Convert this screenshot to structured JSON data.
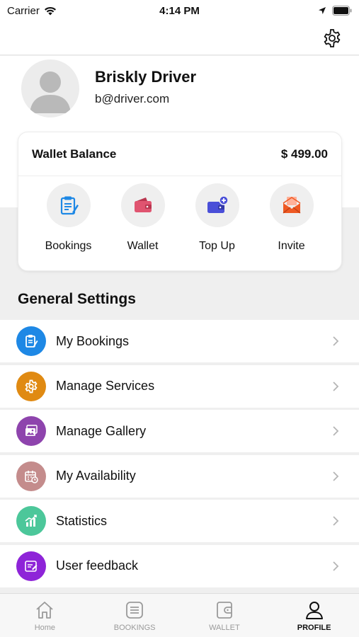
{
  "status_bar": {
    "carrier": "Carrier",
    "time": "4:14 PM"
  },
  "profile": {
    "name": "Briskly Driver",
    "email": "b@driver.com"
  },
  "wallet": {
    "label": "Wallet Balance",
    "amount": "$ 499.00",
    "actions": [
      {
        "label": "Bookings",
        "icon": "clipboard-icon",
        "color": "#1e88e5"
      },
      {
        "label": "Wallet",
        "icon": "wallet-icon",
        "color": "#e05470"
      },
      {
        "label": "Top Up",
        "icon": "top-up-icon",
        "color": "#4a4fd8"
      },
      {
        "label": "Invite",
        "icon": "envelope-icon",
        "color": "#ef5a24"
      }
    ]
  },
  "general_settings": {
    "title": "General Settings",
    "items": [
      {
        "label": "My Bookings",
        "icon": "clipboard-icon",
        "color": "#1e88e5"
      },
      {
        "label": "Manage Services",
        "icon": "gear-icon",
        "color": "#e08a12"
      },
      {
        "label": "Manage Gallery",
        "icon": "gallery-icon",
        "color": "#8e44ad"
      },
      {
        "label": "My Availability",
        "icon": "calendar-icon",
        "color": "#c48c8c"
      },
      {
        "label": "Statistics",
        "icon": "chart-icon",
        "color": "#4cc79a"
      },
      {
        "label": "User feedback",
        "icon": "feedback-icon",
        "color": "#8e24d8"
      }
    ]
  },
  "tab_bar": {
    "tabs": [
      {
        "label": "Home",
        "icon": "home-icon",
        "active": false
      },
      {
        "label": "BOOKINGS",
        "icon": "list-icon",
        "active": false
      },
      {
        "label": "WALLET",
        "icon": "wallet-icon",
        "active": false
      },
      {
        "label": "PROFILE",
        "icon": "person-icon",
        "active": true
      }
    ]
  }
}
